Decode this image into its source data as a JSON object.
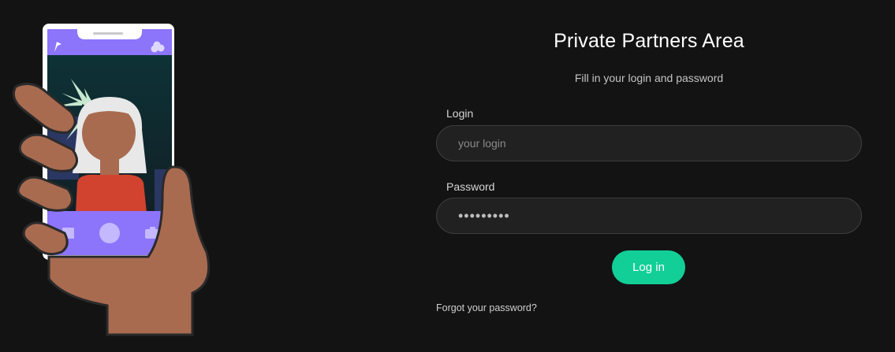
{
  "form": {
    "title": "Private Partners Area",
    "subtitle": "Fill in your login and password",
    "login_label": "Login",
    "login_placeholder": "your login",
    "login_value": "",
    "password_label": "Password",
    "password_value": "•••••••••",
    "submit_label": "Log in",
    "forgot_link": "Forgot your password?"
  },
  "colors": {
    "background": "#131313",
    "accent": "#12cf98",
    "field_background": "#212121",
    "phone_ui": "#8c74fb",
    "skin": "#a86b50"
  },
  "illustration": {
    "icons": [
      "flag-icon",
      "camera-icon",
      "gallery-icon",
      "shutter-icon",
      "filter-icon"
    ]
  }
}
